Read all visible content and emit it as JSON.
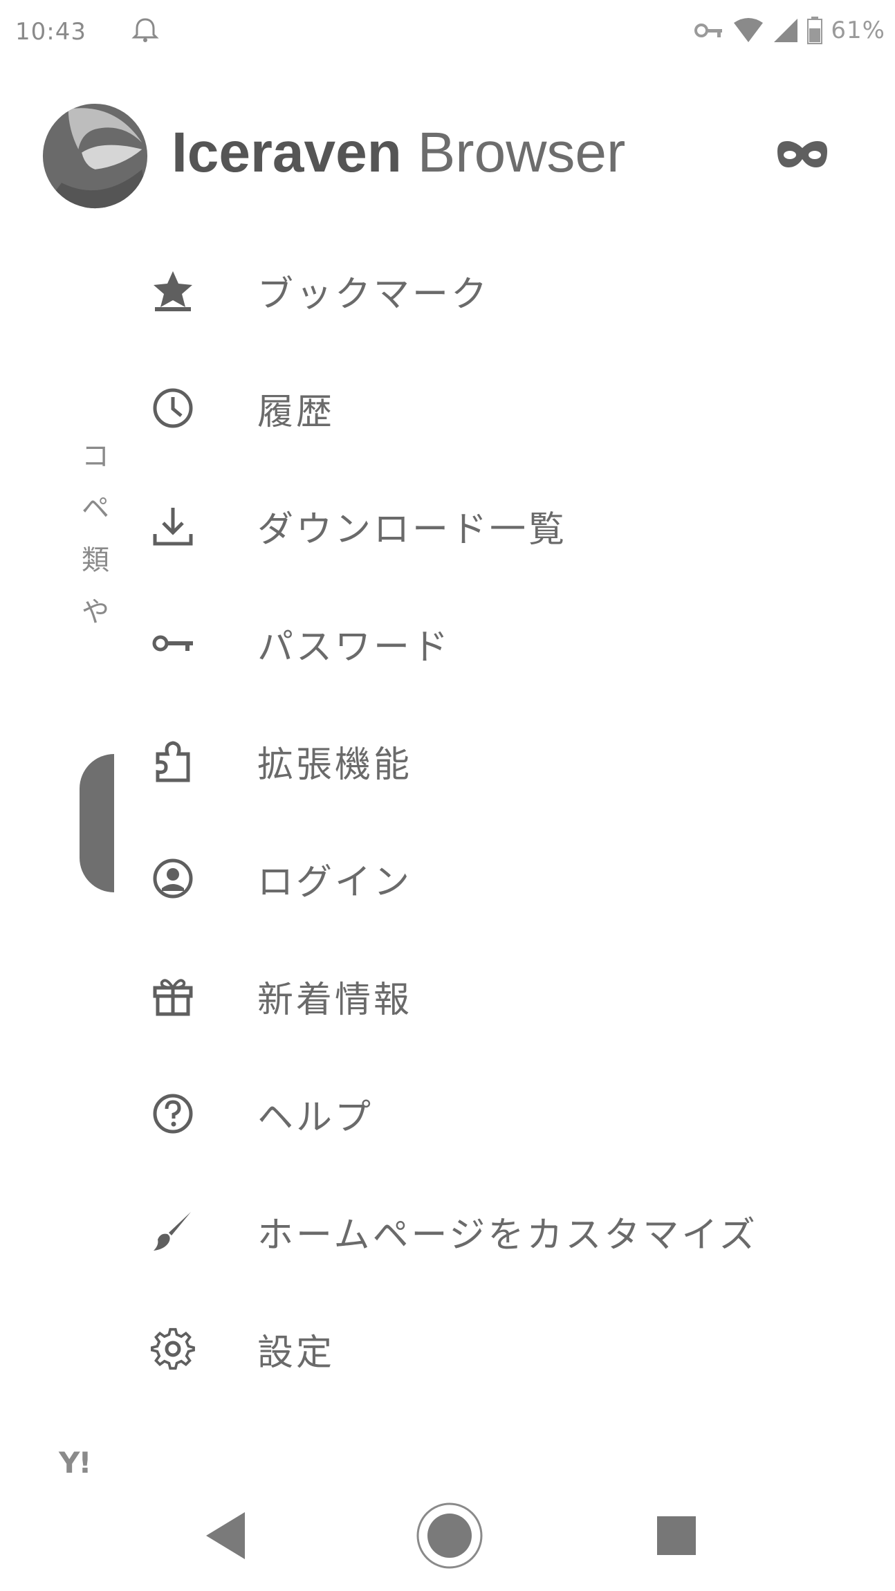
{
  "status_bar": {
    "time": "10:43",
    "battery": "61%",
    "icons": [
      "notification-icon",
      "vpn-key-icon",
      "wifi-icon",
      "signal-icon",
      "battery-icon"
    ]
  },
  "background_page": {
    "vertical_text": [
      "コ",
      "ペ",
      "類",
      "や"
    ],
    "logo_text": "Y!"
  },
  "drawer": {
    "brand_bold": "Iceraven",
    "brand_light": " Browser",
    "menu": [
      {
        "id": "bookmarks",
        "label": "ブックマーク",
        "icon": "bookmark-star-icon"
      },
      {
        "id": "history",
        "label": "履歴",
        "icon": "history-clock-icon"
      },
      {
        "id": "downloads",
        "label": "ダウンロード一覧",
        "icon": "download-icon"
      },
      {
        "id": "passwords",
        "label": "パスワード",
        "icon": "key-icon"
      },
      {
        "id": "addons",
        "label": "拡張機能",
        "icon": "puzzle-icon"
      },
      {
        "id": "login",
        "label": "ログイン",
        "icon": "account-icon"
      },
      {
        "id": "whats-new",
        "label": "新着情報",
        "icon": "gift-icon"
      },
      {
        "id": "help",
        "label": "ヘルプ",
        "icon": "help-icon"
      },
      {
        "id": "customize-home",
        "label": "ホームページをカスタマイズ",
        "icon": "brush-icon"
      },
      {
        "id": "settings",
        "label": "設定",
        "icon": "gear-icon"
      }
    ]
  },
  "colors": {
    "icon": "#6a6a6a",
    "text": "#6a6a6a",
    "background": "#ffffff"
  }
}
